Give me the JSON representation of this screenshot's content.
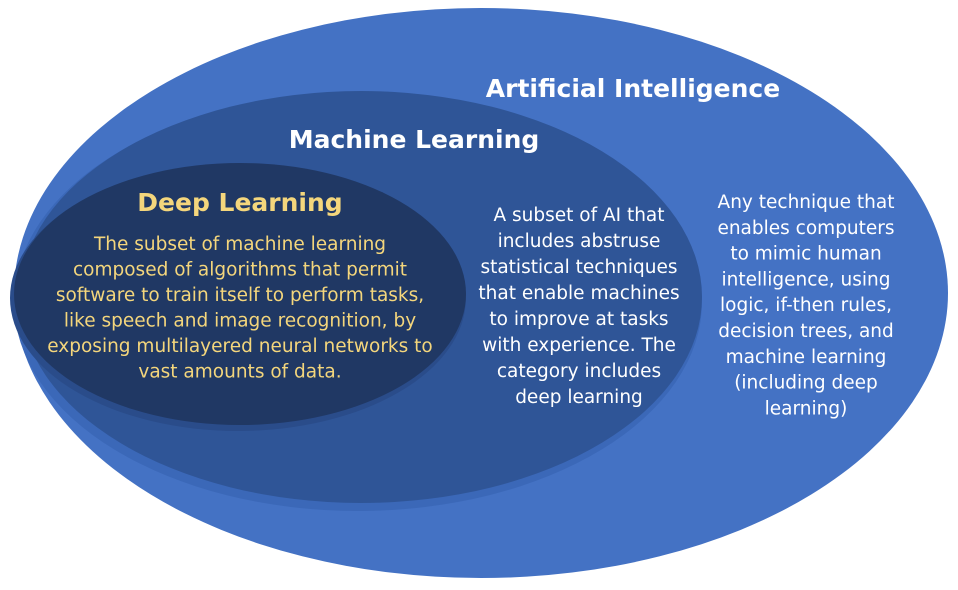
{
  "diagram": {
    "type": "nested-ellipses",
    "colors": {
      "outer_fill": "#4472C4",
      "middle_fill": "#2F5597",
      "inner_fill": "#203864",
      "white_text": "#FFFFFF",
      "gold_text": "#F4D67C",
      "background": "#FFFFFF"
    },
    "artificial_intelligence": {
      "title": "Artificial Intelligence",
      "description_lines": [
        "Any technique that",
        "enables computers",
        "to mimic human",
        "intelligence, using",
        "logic, if-then rules,",
        "decision trees, and",
        "machine learning",
        "(including deep",
        "learning)"
      ]
    },
    "machine_learning": {
      "title": "Machine Learning",
      "description_lines": [
        "A subset of AI that",
        "includes abstruse",
        "statistical techniques",
        "that enable machines",
        "to improve at tasks",
        "with experience. The",
        "category includes",
        "deep learning"
      ]
    },
    "deep_learning": {
      "title": "Deep Learning",
      "description_lines": [
        "The subset of machine learning",
        "composed of algorithms that permit",
        "software to train itself to perform tasks,",
        "like speech and image recognition, by",
        "exposing multilayered neural networks to",
        "vast amounts of data."
      ]
    }
  }
}
